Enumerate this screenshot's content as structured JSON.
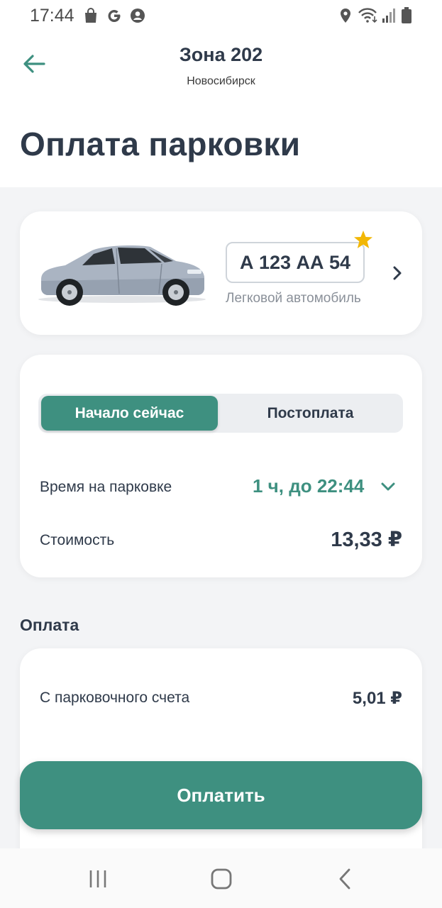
{
  "status_bar": {
    "time": "17:44",
    "left_icons": [
      "shopping-bag-icon",
      "google-icon",
      "account-icon"
    ],
    "right_icons": [
      "location-icon",
      "wifi-icon",
      "signal-icon",
      "battery-icon"
    ]
  },
  "header": {
    "back_icon": "arrow-left-icon",
    "title": "Зона 202",
    "subtitle": "Новосибирск"
  },
  "page": {
    "title": "Оплата парковки"
  },
  "vehicle": {
    "plate": "А 123 АА 54",
    "type": "Легковой автомобиль",
    "favorite_icon": "star-icon",
    "image": "car-icon"
  },
  "parking": {
    "tabs": [
      {
        "label": "Начало сейчас",
        "active": true
      },
      {
        "label": "Постоплата",
        "active": false
      }
    ],
    "time_label": "Время на парковке",
    "time_value": "1 ч, до 22:44",
    "cost_label": "Стоимость",
    "cost_value": "13,33 ₽"
  },
  "payment": {
    "section_title": "Оплата",
    "account_label": "С парковочного счета",
    "account_value": "5,01 ₽",
    "pay_button": "Оплатить"
  },
  "colors": {
    "accent": "#3e9080",
    "text": "#2f3a4a",
    "muted": "#8a9099",
    "background": "#f3f4f6",
    "star": "#f2b705"
  },
  "nav_bar": [
    "recent-apps-icon",
    "home-icon",
    "back-icon"
  ]
}
